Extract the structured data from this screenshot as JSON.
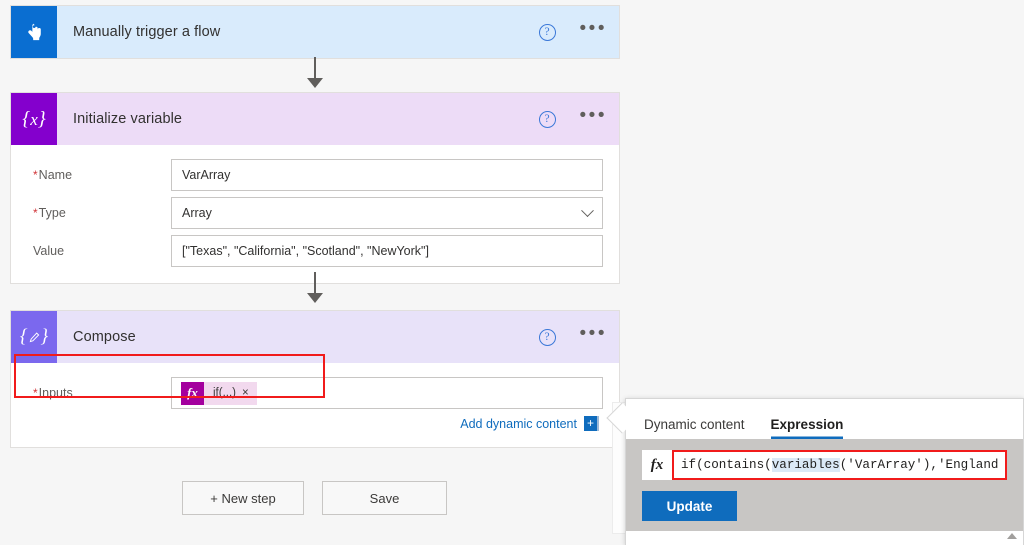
{
  "background_color": "#f6f6f6",
  "flow": {
    "steps": [
      {
        "id": "trigger",
        "title": "Manually trigger a flow",
        "icon": "touch-hand-icon",
        "header_color": "#d9ebfc",
        "icon_color": "#0a6ed1",
        "help_label": "?",
        "menu_label": "•••"
      },
      {
        "id": "initialize-variable",
        "title": "Initialize variable",
        "icon": "braces-x-icon",
        "header_color": "#eddcf7",
        "icon_color": "#8400cd",
        "help_label": "?",
        "menu_label": "•••",
        "fields": [
          {
            "label": "Name",
            "required": true,
            "value": "VarArray",
            "type": "text"
          },
          {
            "label": "Type",
            "required": true,
            "value": "Array",
            "type": "select"
          },
          {
            "label": "Value",
            "required": false,
            "value": "[\"Texas\", \"California\", \"Scotland\", \"NewYork\"]",
            "type": "text"
          }
        ]
      },
      {
        "id": "compose",
        "title": "Compose",
        "icon": "braces-pencil-icon",
        "header_color": "#e8e2f9",
        "icon_color": "#7b68ee",
        "help_label": "?",
        "menu_label": "•••",
        "inputs_label": "Inputs",
        "inputs_required": true,
        "token": {
          "fx_label": "fx",
          "text": "if(...)",
          "remove_label": "×"
        },
        "dynamic_content_link": "Add dynamic content",
        "dynamic_content_plus": "+"
      }
    ]
  },
  "actions": {
    "new_step": "+ New step",
    "save": "Save"
  },
  "expression_panel": {
    "tabs": [
      {
        "label": "Dynamic content",
        "active": false
      },
      {
        "label": "Expression",
        "active": true
      }
    ],
    "fx_label": "fx",
    "expression_prefix": "if(contains(",
    "expression_highlight": "variables",
    "expression_suffix": "('VarArray'),'England",
    "expression_full": "if(contains(variables('VarArray'),'England",
    "update_button": "Update"
  },
  "annotations": {
    "inputs_highlight_color": "#f11b1b",
    "expression_highlight_color": "#f11b1b"
  }
}
